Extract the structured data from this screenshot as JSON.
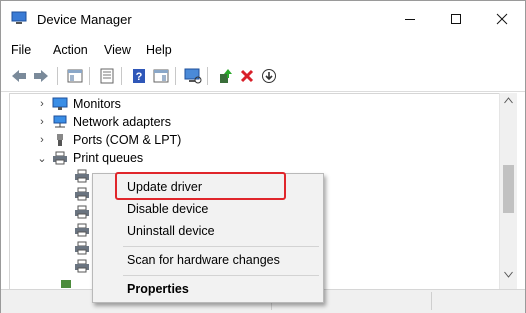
{
  "window": {
    "title": "Device Manager"
  },
  "menu": {
    "items": [
      "File",
      "Action",
      "View",
      "Help"
    ]
  },
  "toolbar": {
    "icons": [
      "back-icon",
      "forward-icon",
      "show-hide-tree-icon",
      "properties-icon",
      "help-icon",
      "view-icon",
      "scan-hardware-icon",
      "update-driver-icon",
      "uninstall-icon",
      "download-icon"
    ]
  },
  "tree": {
    "nodes": [
      {
        "label": "Monitors",
        "expanded": false,
        "icon": "monitor-icon"
      },
      {
        "label": "Network adapters",
        "expanded": false,
        "icon": "network-adapter-icon"
      },
      {
        "label": "Ports (COM & LPT)",
        "expanded": false,
        "icon": "port-icon"
      },
      {
        "label": "Print queues",
        "expanded": true,
        "icon": "printer-icon"
      }
    ]
  },
  "context_menu": {
    "items": [
      {
        "label": "Update driver",
        "highlighted": true
      },
      {
        "label": "Disable device"
      },
      {
        "label": "Uninstall device"
      },
      {
        "label": "Scan for hardware changes"
      },
      {
        "label": "Properties",
        "bold": true
      }
    ],
    "highlight_color": "#e0262b"
  }
}
